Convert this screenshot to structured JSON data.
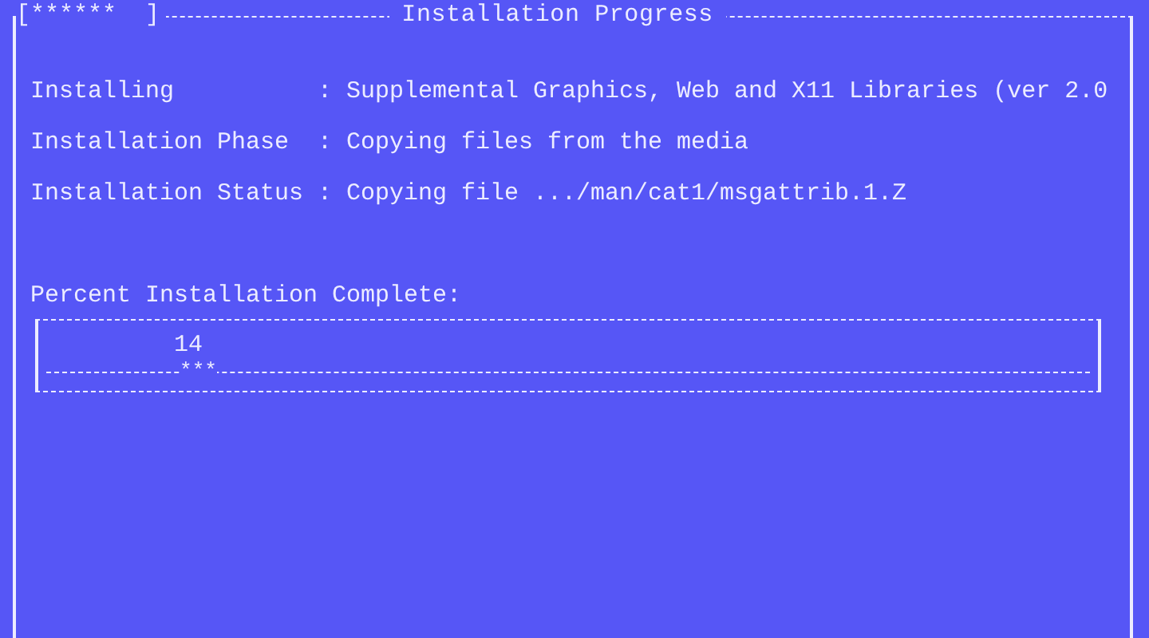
{
  "window": {
    "title": "Installation Progress",
    "spinner": "[******  ]"
  },
  "fields": [
    {
      "label": "Installing",
      "separator": ":",
      "value": "Supplemental Graphics, Web and X11 Libraries (ver 2.0"
    },
    {
      "label": "Installation Phase",
      "separator": ":",
      "value": "Copying files from the media"
    },
    {
      "label": "Installation Status",
      "separator": ":",
      "value": "Copying file .../man/cat1/msgattrib.1.Z"
    }
  ],
  "progress": {
    "label": "Percent Installation Complete:",
    "percent": "14",
    "marker": "***",
    "level": 0.14
  }
}
